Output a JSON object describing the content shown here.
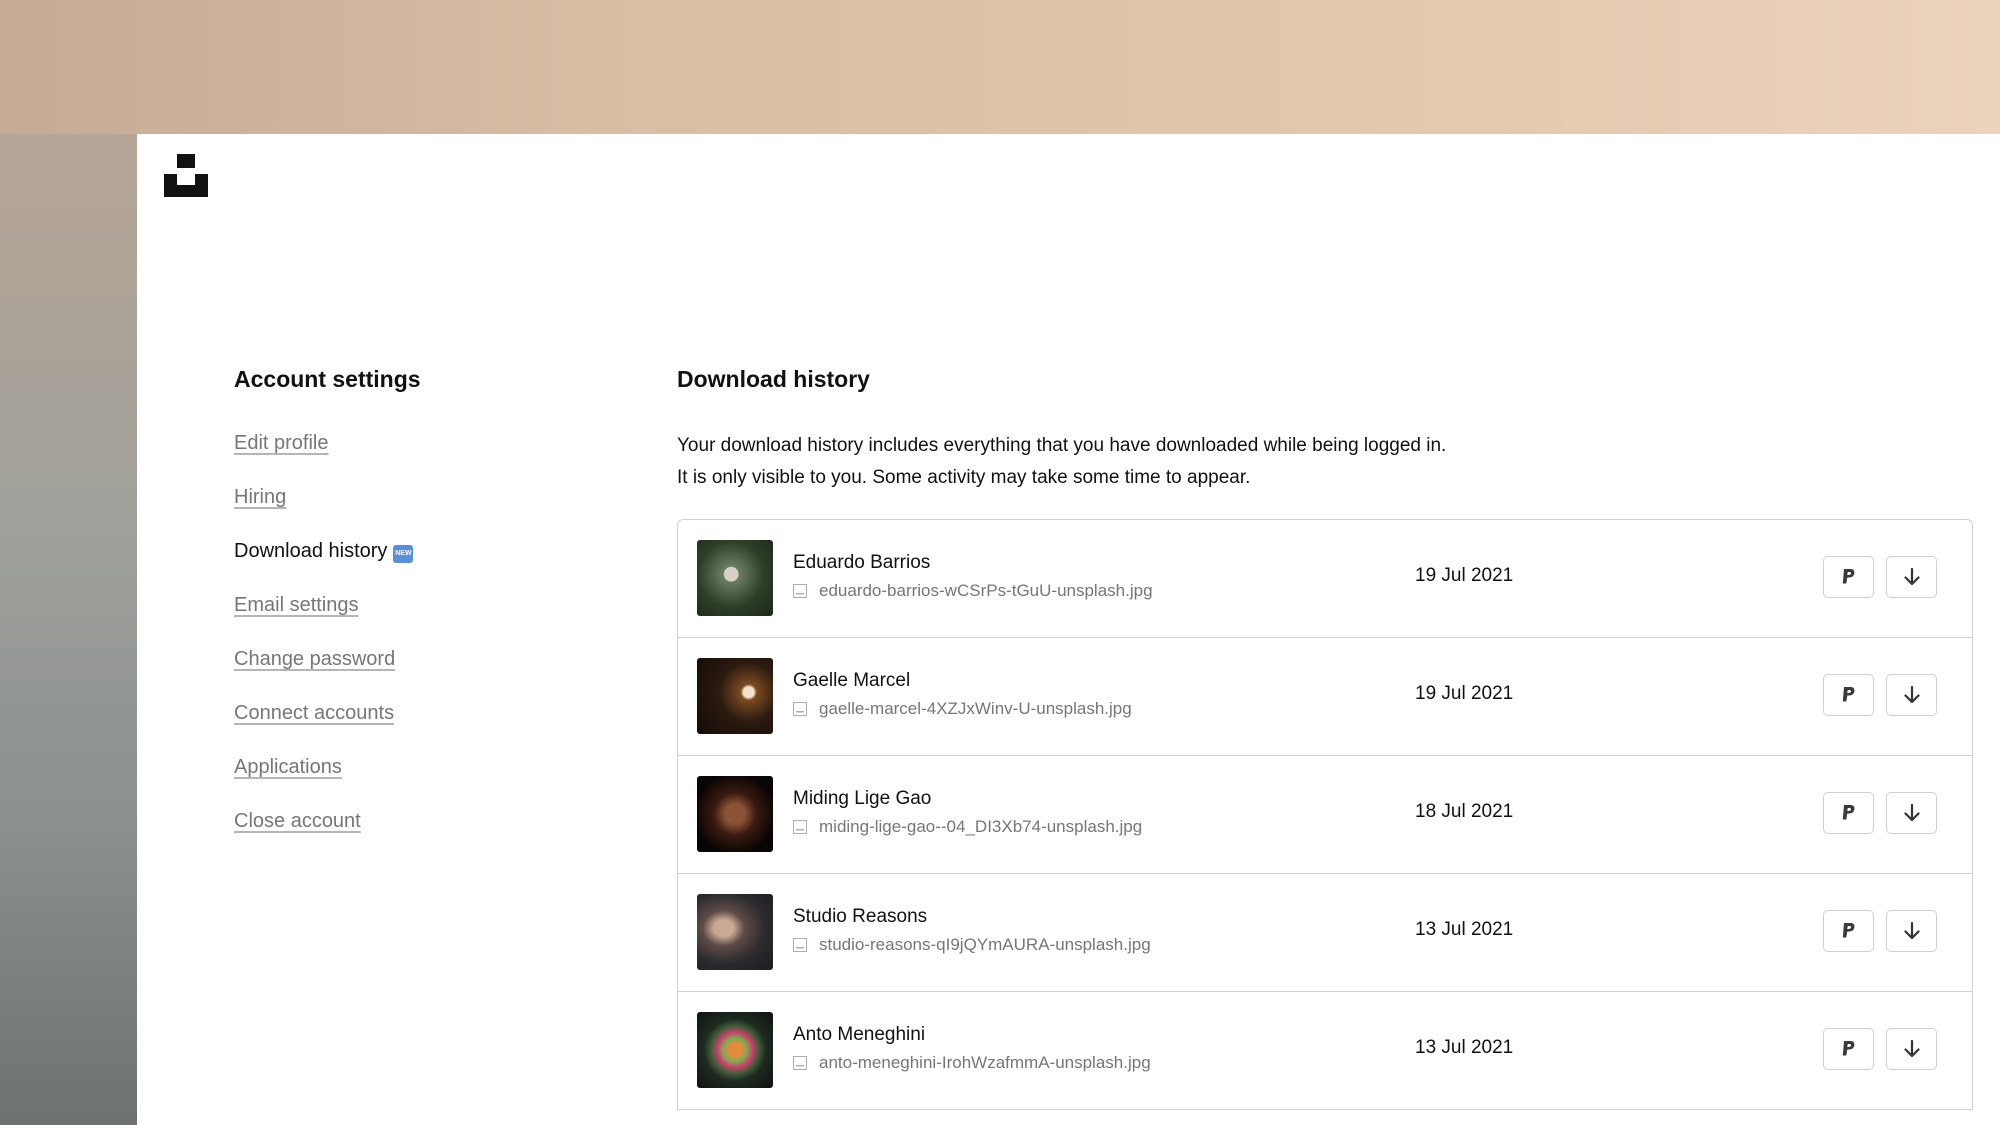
{
  "sidebar": {
    "title": "Account settings",
    "items": [
      {
        "label": "Edit profile",
        "active": false
      },
      {
        "label": "Hiring",
        "active": false
      },
      {
        "label": "Download history",
        "active": true,
        "badge": "NEW"
      },
      {
        "label": "Email settings",
        "active": false
      },
      {
        "label": "Change password",
        "active": false
      },
      {
        "label": "Connect accounts",
        "active": false
      },
      {
        "label": "Applications",
        "active": false
      },
      {
        "label": "Close account",
        "active": false
      }
    ]
  },
  "main": {
    "title": "Download history",
    "description_line1": "Your download history includes everything that you have downloaded while being logged in.",
    "description_line2": "It is only visible to you. Some activity may take some time to appear.",
    "downloads": [
      {
        "photographer": "Eduardo Barrios",
        "filename": "eduardo-barrios-wCSrPs-tGuU-unsplash.jpg",
        "date": "19 Jul 2021"
      },
      {
        "photographer": "Gaelle Marcel",
        "filename": "gaelle-marcel-4XZJxWinv-U-unsplash.jpg",
        "date": "19 Jul 2021"
      },
      {
        "photographer": "Miding Lige Gao",
        "filename": "miding-lige-gao--04_DI3Xb74-unsplash.jpg",
        "date": "18 Jul 2021"
      },
      {
        "photographer": "Studio Reasons",
        "filename": "studio-reasons-qI9jQYmAURA-unsplash.jpg",
        "date": "13 Jul 2021"
      },
      {
        "photographer": "Anto Meneghini",
        "filename": "anto-meneghini-IrohWzafmmA-unsplash.jpg",
        "date": "13 Jul 2021"
      }
    ]
  },
  "icons": {
    "logo": "unsplash-logo-icon",
    "file": "image-file-icon",
    "paypal": "paypal-icon",
    "download": "arrow-down-icon"
  },
  "colors": {
    "badge": "#5a8fd6",
    "muted_text": "#767676",
    "border": "#d1d1d1"
  }
}
